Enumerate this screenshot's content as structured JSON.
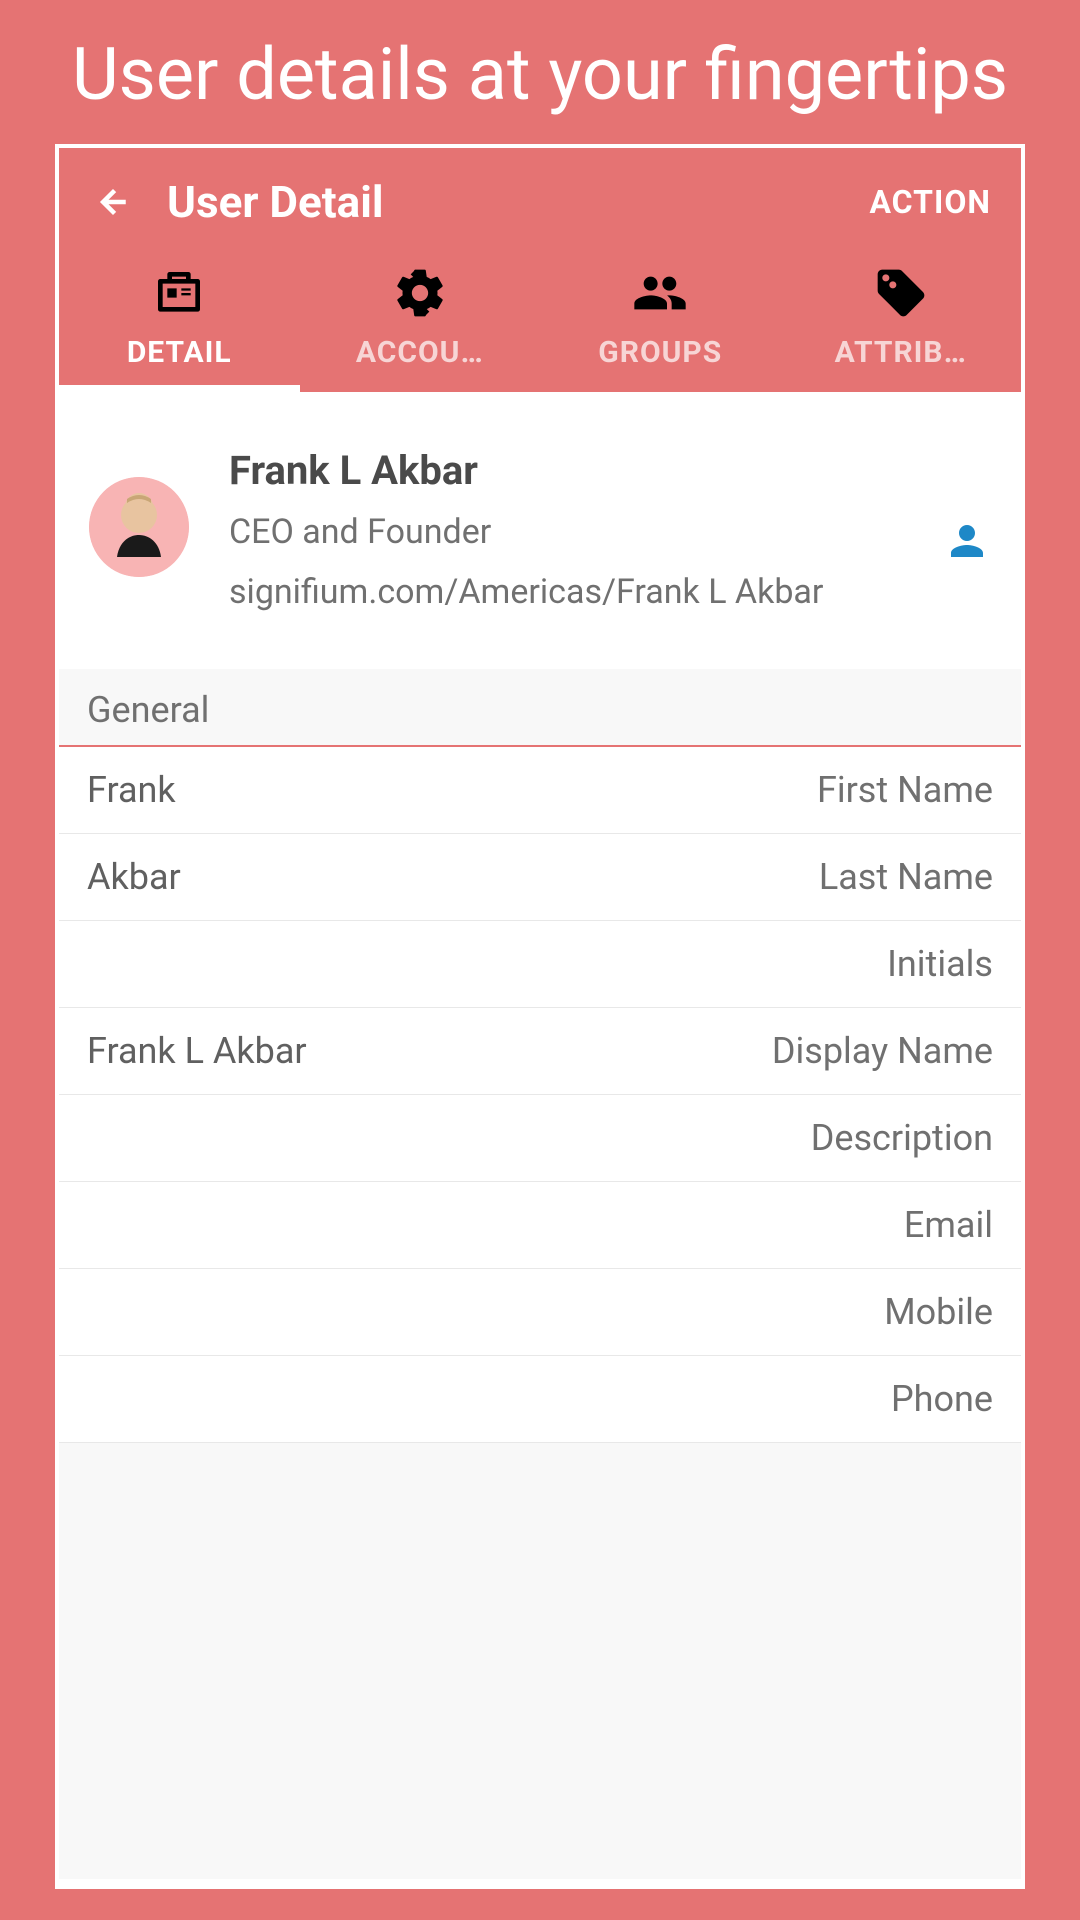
{
  "hero": {
    "title": "User details at your fingertips"
  },
  "header": {
    "title": "User Detail",
    "action": "ACTION"
  },
  "tabs": [
    {
      "label": "DETAIL",
      "active": true
    },
    {
      "label": "ACCOU…",
      "active": false
    },
    {
      "label": "GROUPS",
      "active": false
    },
    {
      "label": "ATTRIB…",
      "active": false
    }
  ],
  "profile": {
    "name": "Frank L Akbar",
    "title": "CEO and Founder",
    "path": "signifium.com/Americas/Frank L Akbar"
  },
  "section": {
    "general": "General"
  },
  "fields": [
    {
      "value": "Frank",
      "label": "First Name"
    },
    {
      "value": "Akbar",
      "label": "Last Name"
    },
    {
      "value": "",
      "label": "Initials"
    },
    {
      "value": "Frank L Akbar",
      "label": "Display Name"
    },
    {
      "value": "",
      "label": "Description"
    },
    {
      "value": "",
      "label": "Email"
    },
    {
      "value": "",
      "label": "Mobile"
    },
    {
      "value": "",
      "label": "Phone"
    }
  ]
}
